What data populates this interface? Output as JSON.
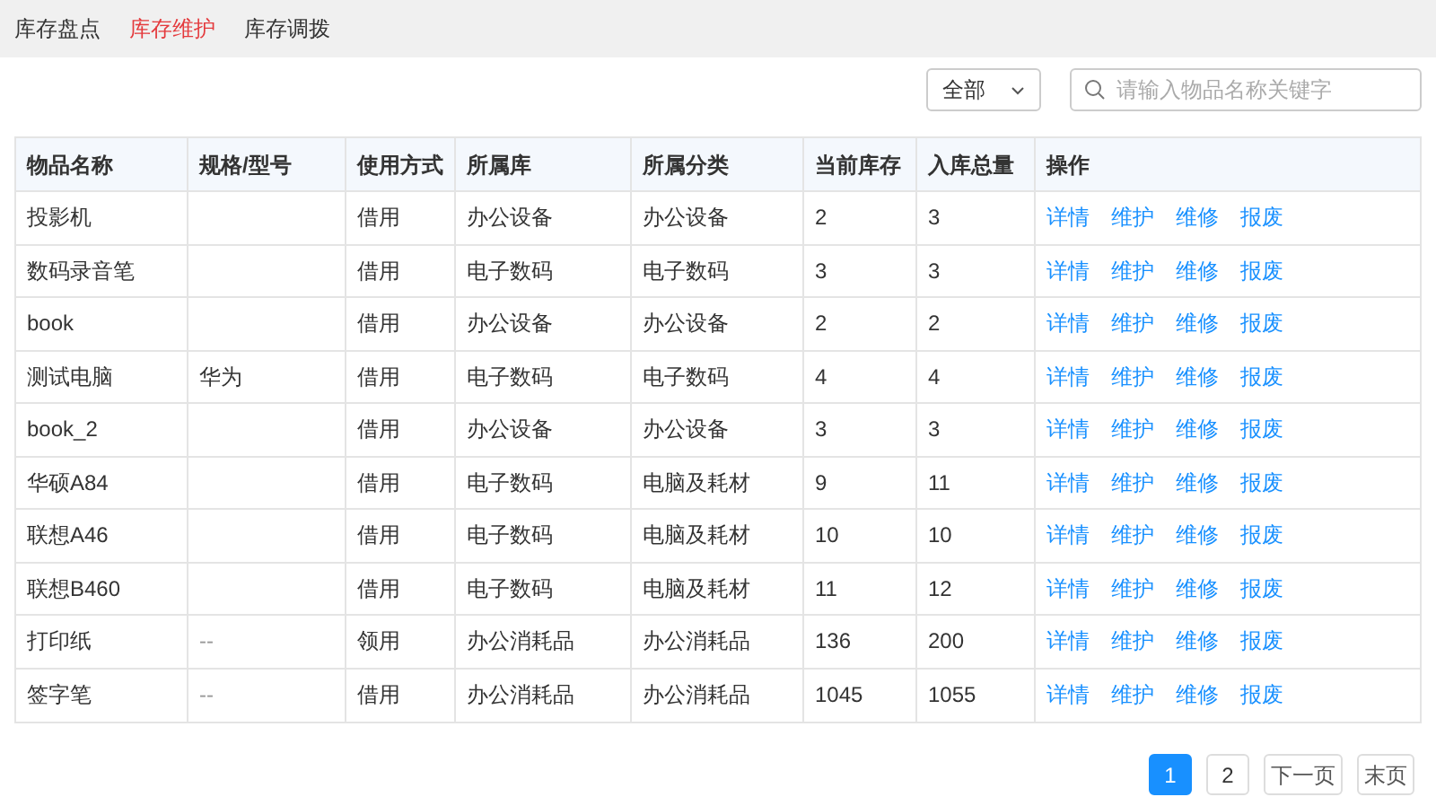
{
  "tabs": [
    {
      "label": "库存盘点",
      "selected": false
    },
    {
      "label": "库存维护",
      "selected": true
    },
    {
      "label": "库存调拨",
      "selected": false
    }
  ],
  "filter": {
    "value": "全部"
  },
  "search": {
    "placeholder": "请输入物品名称关键字"
  },
  "table": {
    "columns": [
      "物品名称",
      "规格/型号",
      "使用方式",
      "所属库",
      "所属分类",
      "当前库存",
      "入库总量",
      "操作"
    ],
    "rows": [
      {
        "cells": [
          "投影机",
          "",
          "借用",
          "办公设备",
          "办公设备",
          "2",
          "3"
        ],
        "actions": [
          "详情",
          "维护",
          "维修",
          "报废"
        ]
      },
      {
        "cells": [
          "数码录音笔",
          "",
          "借用",
          "电子数码",
          "电子数码",
          "3",
          "3"
        ],
        "actions": [
          "详情",
          "维护",
          "维修",
          "报废"
        ]
      },
      {
        "cells": [
          "book",
          "",
          "借用",
          "办公设备",
          "办公设备",
          "2",
          "2"
        ],
        "actions": [
          "详情",
          "维护",
          "维修",
          "报废"
        ]
      },
      {
        "cells": [
          "测试电脑",
          "华为",
          "借用",
          "电子数码",
          "电子数码",
          "4",
          "4"
        ],
        "actions": [
          "详情",
          "维护",
          "维修",
          "报废"
        ]
      },
      {
        "cells": [
          "book_2",
          "",
          "借用",
          "办公设备",
          "办公设备",
          "3",
          "3"
        ],
        "actions": [
          "详情",
          "维护",
          "维修",
          "报废"
        ]
      },
      {
        "cells": [
          "华硕A84",
          "",
          "借用",
          "电子数码",
          "电脑及耗材",
          "9",
          "11"
        ],
        "actions": [
          "详情",
          "维护",
          "维修",
          "报废"
        ]
      },
      {
        "cells": [
          "联想A46",
          "",
          "借用",
          "电子数码",
          "电脑及耗材",
          "10",
          "10"
        ],
        "actions": [
          "详情",
          "维护",
          "维修",
          "报废"
        ]
      },
      {
        "cells": [
          "联想B460",
          "",
          "借用",
          "电子数码",
          "电脑及耗材",
          "11",
          "12"
        ],
        "actions": [
          "详情",
          "维护",
          "维修",
          "报废"
        ]
      },
      {
        "cells": [
          "打印纸",
          "--",
          "领用",
          "办公消耗品",
          "办公消耗品",
          "136",
          "200"
        ],
        "actions": [
          "详情",
          "维护",
          "维修",
          "报废"
        ]
      },
      {
        "cells": [
          "签字笔",
          "--",
          "借用",
          "办公消耗品",
          "办公消耗品",
          "1045",
          "1055"
        ],
        "actions": [
          "详情",
          "维护",
          "维修",
          "报废"
        ]
      }
    ]
  },
  "pagination": {
    "pages": [
      {
        "label": "1",
        "selected": true
      },
      {
        "label": "2",
        "selected": false
      }
    ],
    "buttons": [
      "下一页",
      "末页"
    ]
  }
}
